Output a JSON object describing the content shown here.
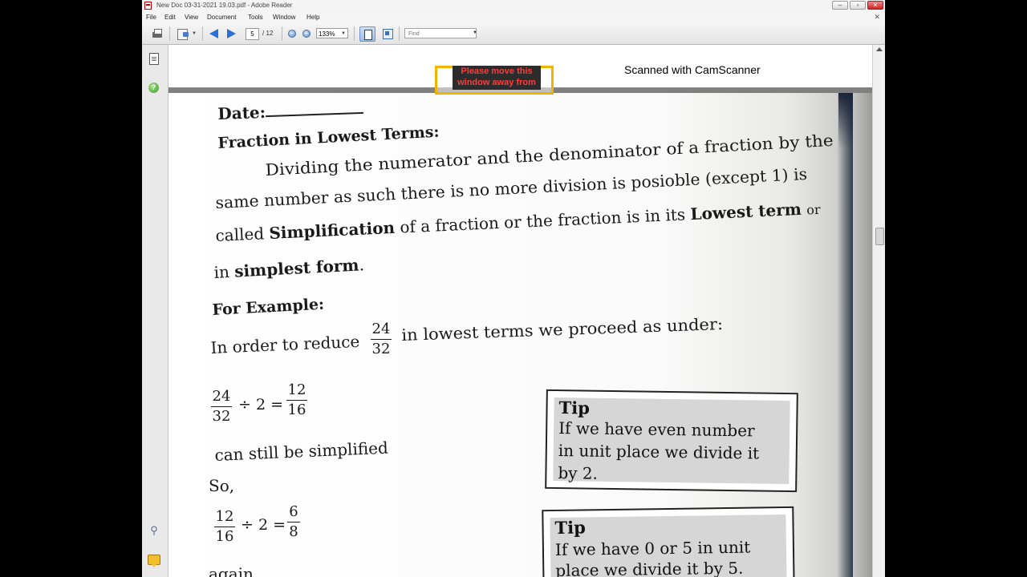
{
  "window": {
    "title": "New Doc 03-31-2021 19.03.pdf - Adobe Reader",
    "min_label": "–",
    "restore_label": "▫",
    "close_label": "✕"
  },
  "menu": {
    "items": [
      "File",
      "Edit",
      "View",
      "Document",
      "Tools",
      "Window",
      "Help"
    ],
    "close_doc": "✕"
  },
  "toolbar": {
    "page_current": "5",
    "page_total": "/ 12",
    "zoom": "133%",
    "find_placeholder": "Find",
    "zoom_out": "−",
    "zoom_in": "+"
  },
  "sidenav": {
    "icons": [
      "pages-icon",
      "help-icon",
      "attachments-icon",
      "comments-icon"
    ]
  },
  "document": {
    "camscanner_label": "Scanned with CamScanner",
    "overlay_text": "Please move this window away from",
    "date_label": "Date:",
    "heading": "Fraction in Lowest Terms:",
    "para": {
      "line1": "Dividing the numerator and the denominator of a fraction by the",
      "line2": "same number as such there is no more division is posioble (except 1) is",
      "line3_a": "called",
      "line3_b": "Simplification",
      "line3_c": "of a fraction or the fraction is in its",
      "line3_d": "Lowest term",
      "line3_e": "or",
      "line4_a": "in",
      "line4_b": "simplest form",
      "line4_c": "."
    },
    "example_heading": "For Example:",
    "reduce_a": "In order to reduce",
    "reduce_b": "in lowest terms we proceed as under:",
    "frac_main": {
      "num": "24",
      "den": "32"
    },
    "step1": {
      "num1": "24",
      "den1": "32",
      "op": "÷ 2 =",
      "num2": "12",
      "den2": "16"
    },
    "can_still": "can still be simplified",
    "so_label": "So,",
    "step2": {
      "num1": "12",
      "den1": "16",
      "op": "÷ 2 =",
      "num2": "6",
      "den2": "8"
    },
    "again_label": "again",
    "tip1": {
      "title": "Tip",
      "lines": [
        "If we have even number",
        "in unit place we divide it",
        "by 2."
      ]
    },
    "tip2": {
      "title": "Tip",
      "lines": [
        "If we have 0 or 5 in unit",
        "place we divide it by 5."
      ]
    }
  },
  "colors": {
    "accent": "#2a6fd1",
    "overlay_border": "#f0b400",
    "overlay_text": "#ff3b3b"
  }
}
